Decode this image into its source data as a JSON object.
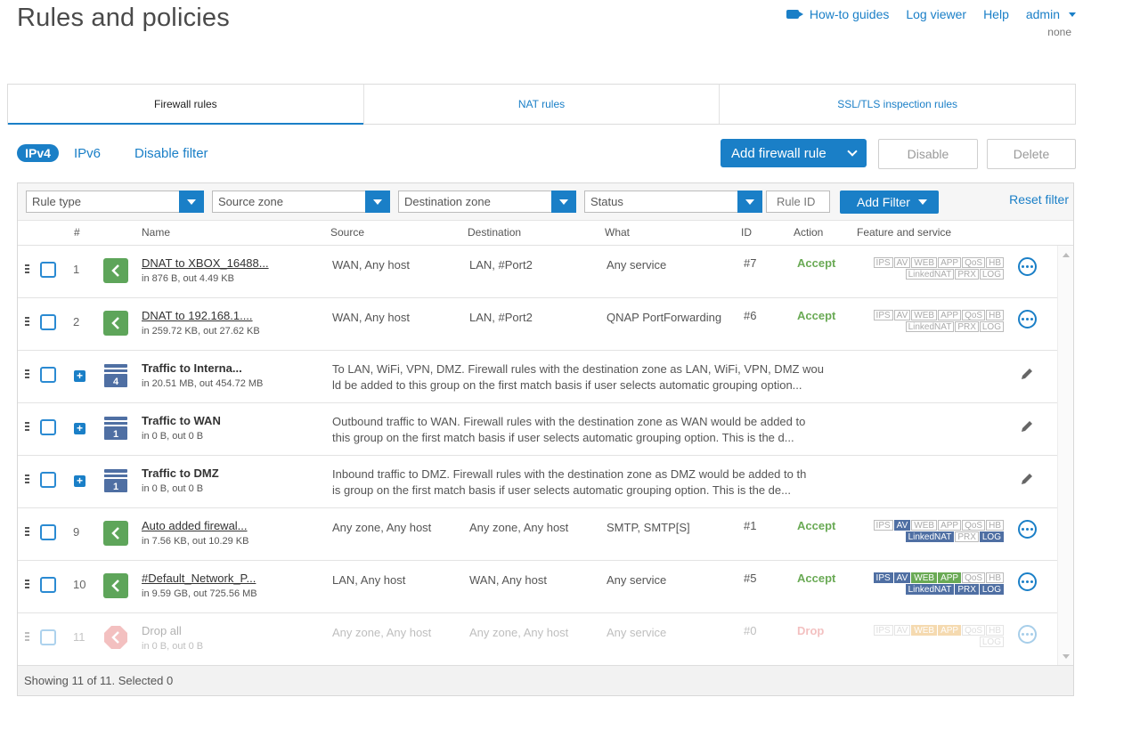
{
  "page": {
    "title": "Rules and policies"
  },
  "topnav": {
    "howto": "How-to guides",
    "logviewer": "Log viewer",
    "help": "Help",
    "user": "admin",
    "subuser": "none"
  },
  "tabs": [
    {
      "label": "Firewall rules",
      "active": true
    },
    {
      "label": "NAT rules",
      "active": false
    },
    {
      "label": "SSL/TLS inspection rules",
      "active": false
    }
  ],
  "filterbar": {
    "ipv4": "IPv4",
    "ipv6": "IPv6",
    "disable_filter": "Disable filter",
    "add_rule": "Add firewall rule",
    "disable": "Disable",
    "delete": "Delete"
  },
  "filters": {
    "rule_type": "Rule type",
    "source_zone": "Source zone",
    "destination_zone": "Destination zone",
    "status": "Status",
    "rule_id_placeholder": "Rule ID",
    "add_filter": "Add Filter",
    "reset": "Reset filter"
  },
  "columns": {
    "num": "#",
    "name": "Name",
    "source": "Source",
    "destination": "Destination",
    "what": "What",
    "id": "ID",
    "action": "Action",
    "feature": "Feature and service"
  },
  "rows": [
    {
      "num": "1",
      "name": "DNAT to XBOX_16488...",
      "traffic": "in 876 B, out 4.49 KB",
      "source": "WAN, Any host",
      "destination": "LAN, #Port2",
      "what": "Any service",
      "id": "#7",
      "action": "Accept"
    },
    {
      "num": "2",
      "name": "DNAT to 192.168.1....",
      "traffic": "in 259.72 KB, out 27.62 KB",
      "source": "WAN, Any host",
      "destination": "LAN, #Port2",
      "what": "QNAP PortForwarding",
      "id": "#6",
      "action": "Accept"
    },
    {
      "name": "Traffic to Interna...",
      "traffic": "in 20.51 MB, out 454.72 MB",
      "count": "4",
      "desc1": "To LAN, WiFi, VPN, DMZ. Firewall rules with the destination zone as LAN, WiFi, VPN, DMZ wou",
      "desc2": "ld be added to this group on the first match basis if user selects automatic grouping option..."
    },
    {
      "name": "Traffic to WAN",
      "traffic": "in 0 B, out 0 B",
      "count": "1",
      "desc1": "Outbound traffic to WAN. Firewall rules with the destination zone as WAN would be added to",
      "desc2": "this group on the first match basis if user selects automatic grouping option. This is the d..."
    },
    {
      "name": "Traffic to DMZ",
      "traffic": "in 0 B, out 0 B",
      "count": "1",
      "desc1": "Inbound traffic to DMZ. Firewall rules with the destination zone as DMZ would be added to th",
      "desc2": "is group on the first match basis if user selects automatic grouping option. This is the de..."
    },
    {
      "num": "9",
      "name": "Auto added firewal...",
      "traffic": "in 7.56 KB, out 10.29 KB",
      "source": "Any zone, Any host",
      "destination": "Any zone, Any host",
      "what": "SMTP, SMTP[S]",
      "id": "#1",
      "action": "Accept"
    },
    {
      "num": "10",
      "name": "#Default_Network_P...",
      "traffic": "in 9.59 GB, out 725.56 MB",
      "source": "LAN, Any host",
      "destination": "WAN, Any host",
      "what": "Any service",
      "id": "#5",
      "action": "Accept"
    },
    {
      "num": "11",
      "name": "Drop all",
      "traffic": "in 0 B, out 0 B",
      "source": "Any zone, Any host",
      "destination": "Any zone, Any host",
      "what": "Any service",
      "id": "#0",
      "action": "Drop"
    }
  ],
  "badges": {
    "ips": "IPS",
    "av": "AV",
    "web": "WEB",
    "app": "APP",
    "qos": "QoS",
    "hb": "HB",
    "linkednat": "LinkedNAT",
    "prx": "PRX",
    "log": "LOG"
  },
  "footer": {
    "status": "Showing 11 of 11. Selected 0"
  },
  "colors": {
    "accent": "#1a7fc7",
    "accept": "#6aaa55",
    "drop": "#e05b5b",
    "badge_on": "#4f6fa3"
  }
}
